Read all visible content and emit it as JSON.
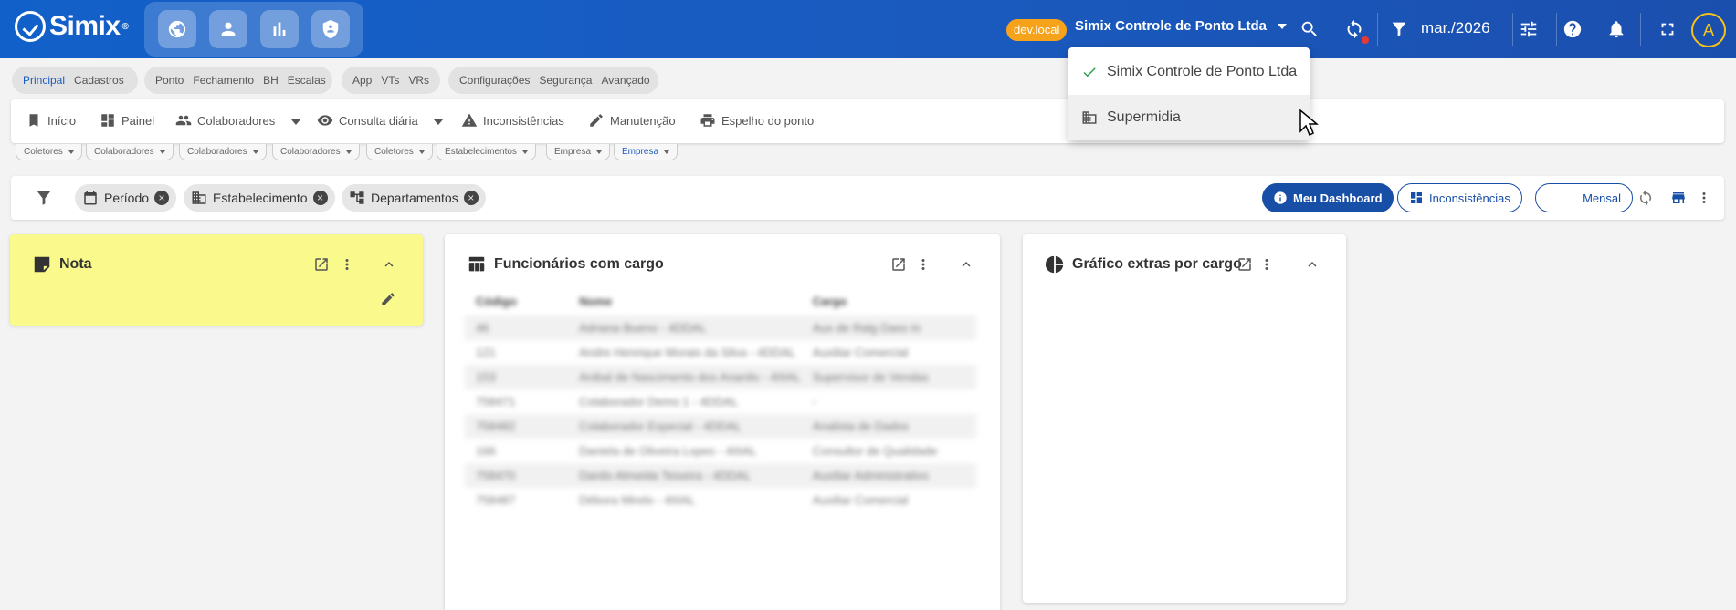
{
  "header": {
    "logo_text": "Simix",
    "logo_mark": "®",
    "modules": [
      "globe-icon",
      "person-icon",
      "bar-chart-icon",
      "shield-icon"
    ],
    "env_badge": "dev.local",
    "company": "Simix Controle de Ponto Ltda",
    "period": "mar./2026",
    "avatar_initial": "A",
    "colors": {
      "primary": "#1a5bc0",
      "badge": "#f7a21b",
      "avatar": "#f7c31b"
    }
  },
  "nav_groups": [
    [
      "Principal",
      "Cadastros"
    ],
    [
      "Ponto",
      "Fechamento",
      "BH",
      "Escalas"
    ],
    [
      "App",
      "VTs",
      "VRs"
    ],
    [
      "Configurações",
      "Segurança",
      "Avançado"
    ]
  ],
  "toolbar": {
    "inicio": "Início",
    "painel": "Painel",
    "colaboradores": "Colaboradores",
    "consulta": "Consulta diária",
    "inconsistencias": "Inconsistências",
    "manutencao": "Manutenção",
    "espelho": "Espelho do ponto"
  },
  "subchips": [
    "Coletores",
    "Colaboradores",
    "Colaboradores",
    "Colaboradores",
    "Coletores",
    "Estabelecimentos",
    "Empresa",
    "Empresa"
  ],
  "filters": {
    "periodo": "Período",
    "estabelecimento": "Estabelecimento",
    "departamentos": "Departamentos",
    "close_symbol": "×"
  },
  "dashboard_buttons": {
    "meu": "Meu Dashboard",
    "inconsistencias": "Inconsistências",
    "mensal": "Mensal"
  },
  "cards": {
    "nota": {
      "title": "Nota"
    },
    "funcionarios": {
      "title": "Funcionários com cargo",
      "columns": [
        "Código",
        "Nome",
        "Cargo"
      ],
      "rows": [
        [
          "46",
          "Adriana Bueno - 4DDAL",
          "Aux de Ralg Dass In"
        ],
        [
          "121",
          "Andre Henrique Morais da Silva - 4DDAL",
          "Auxiliar Comercial"
        ],
        [
          "153",
          "Anibal de Nascimento dos Ananilo - 4IIIAL",
          "Supervisor de Vendas"
        ],
        [
          "758471",
          "Colaborador Demo 1 - 4DDAL",
          "-"
        ],
        [
          "758482",
          "Colaborador Especial - 4DDAL",
          "Analista de Dados"
        ],
        [
          "166",
          "Daniela de Oliveira Lopes - 4IIIAL",
          "Consultor de Qualidade"
        ],
        [
          "758470",
          "Danilo Almeida Teixeira - 4DDAL",
          "Auxiliar Administrativo"
        ],
        [
          "758487",
          "Débora Mirelo - 4IIIAL",
          "Auxiliar Comercial"
        ]
      ]
    },
    "grafico": {
      "title": "Gráfico extras por cargo"
    }
  },
  "menu": {
    "items": [
      {
        "label": "Simix Controle de Ponto Ltda",
        "selected": true
      },
      {
        "label": "Supermidia",
        "selected": false
      }
    ]
  }
}
